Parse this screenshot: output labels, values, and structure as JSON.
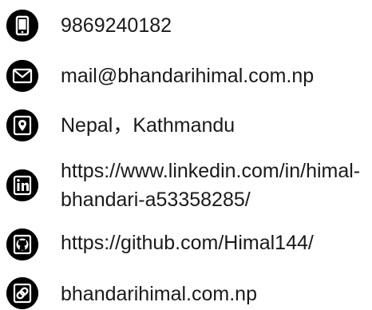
{
  "contacts": [
    {
      "icon": "phone-icon",
      "text": "9869240182"
    },
    {
      "icon": "email-icon",
      "text": "mail@bhandarihimal.com.np"
    },
    {
      "icon": "location-icon",
      "text": "Nepal，Kathmandu"
    },
    {
      "icon": "linkedin-icon",
      "text": "https://www.linkedin.com/in/himal-bhandari-a53358285/"
    },
    {
      "icon": "github-icon",
      "text": "https://github.com/Himal144/"
    },
    {
      "icon": "website-icon",
      "text": "bhandarihimal.com.np"
    }
  ],
  "colors": {
    "icon_bg": "#000000",
    "icon_fg": "#ffffff",
    "text": "#1a1a1a"
  }
}
